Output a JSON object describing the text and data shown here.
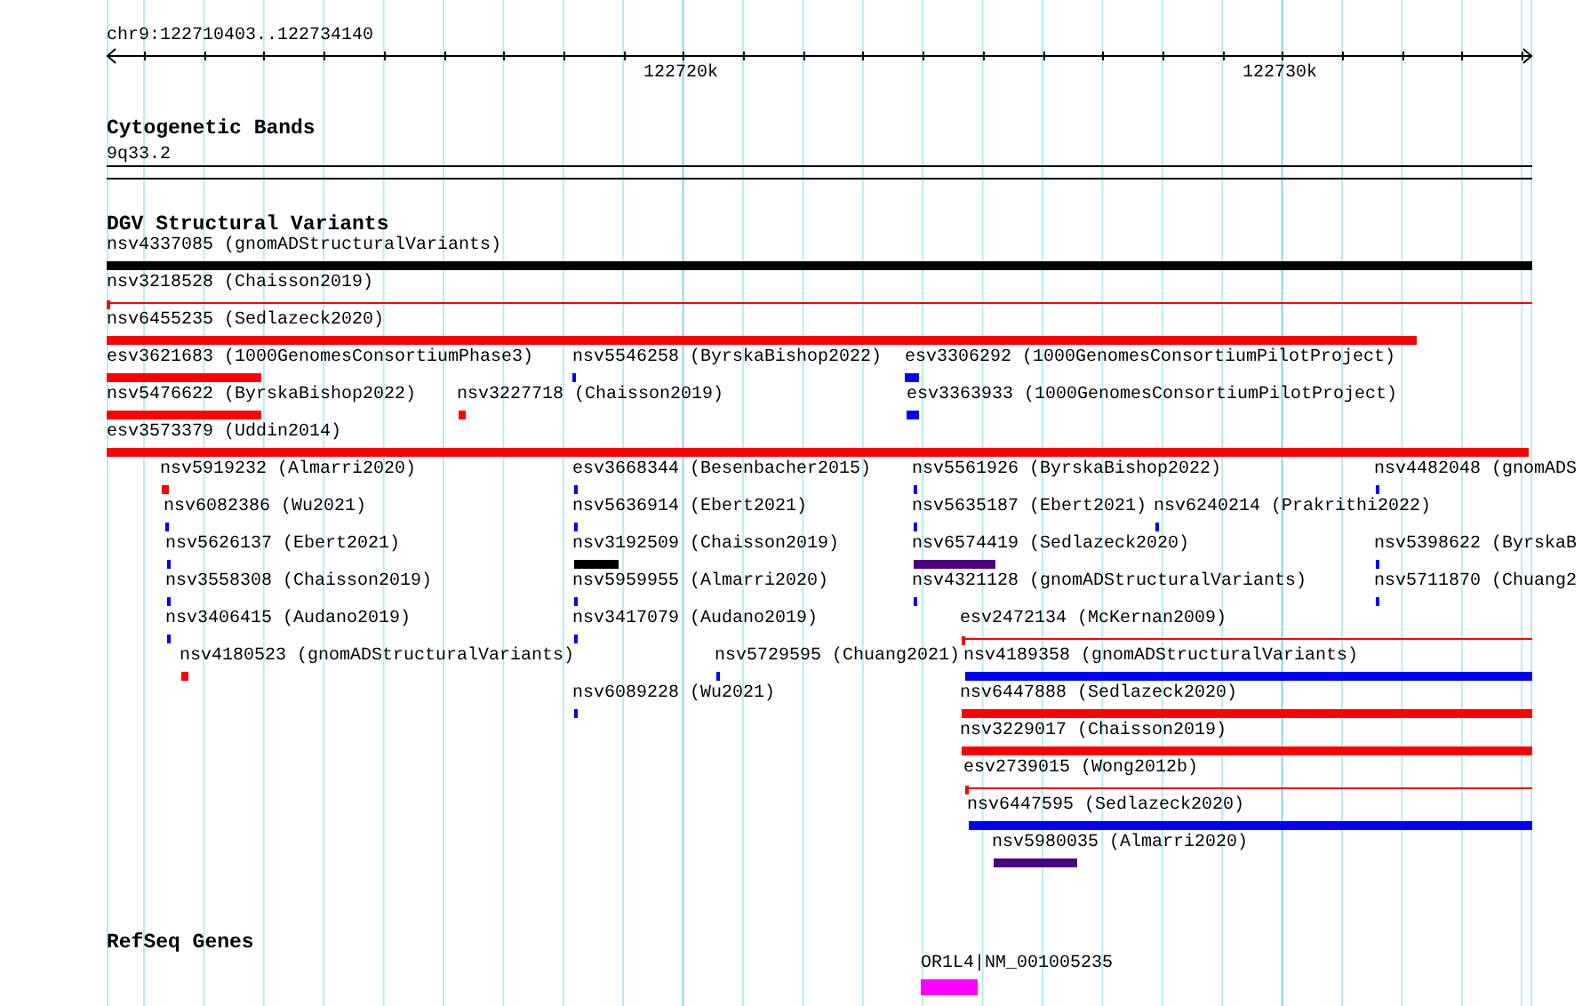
{
  "ruler": {
    "location": "chr9:122710403..122734140",
    "tick_labels": [
      "122720k",
      "122730k"
    ]
  },
  "tracks": [
    {
      "title": "Cytogenetic Bands",
      "features": [
        {
          "label": "9q33.2",
          "kind": "band",
          "color": "#000000"
        }
      ]
    },
    {
      "title": "DGV Structural Variants",
      "features": [
        {
          "label": "nsv4337085 (gnomADStructuralVariants)",
          "kind": "bar",
          "color": "#000000"
        },
        {
          "label": "nsv3218528 (Chaisson2019)",
          "kind": "line",
          "color": "#ff0000"
        },
        {
          "label": "nsv6455235 (Sedlazeck2020)",
          "kind": "bar",
          "color": "#ff0000"
        },
        {
          "label": "esv3621683 (1000GenomesConsortiumPhase3)",
          "kind": "bar",
          "color": "#ff0000"
        },
        {
          "label": "nsv5546258 (ByrskaBishop2022)",
          "kind": "bar",
          "color": "#0000ff"
        },
        {
          "label": "esv3306292 (1000GenomesConsortiumPilotProject)",
          "kind": "bar",
          "color": "#0000ff"
        },
        {
          "label": "nsv5476622 (ByrskaBishop2022)",
          "kind": "bar",
          "color": "#ff0000"
        },
        {
          "label": "nsv3227718 (Chaisson2019)",
          "kind": "bar",
          "color": "#ff0000"
        },
        {
          "label": "esv3363933 (1000GenomesConsortiumPilotProject)",
          "kind": "bar",
          "color": "#0000ff"
        },
        {
          "label": "esv3573379 (Uddin2014)",
          "kind": "bar",
          "color": "#ff0000"
        },
        {
          "label": "nsv5919232 (Almarri2020)",
          "kind": "bar",
          "color": "#ff0000"
        },
        {
          "label": "esv3668344 (Besenbacher2015)",
          "kind": "bar",
          "color": "#0000ff"
        },
        {
          "label": "nsv5561926 (ByrskaBishop2022)",
          "kind": "bar",
          "color": "#0000ff"
        },
        {
          "label": "nsv4482048 (gnomADS",
          "kind": "bar",
          "color": "#0000ff"
        },
        {
          "label": "nsv6082386 (Wu2021)",
          "kind": "bar",
          "color": "#0000ff"
        },
        {
          "label": "nsv5636914 (Ebert2021)",
          "kind": "bar",
          "color": "#0000ff"
        },
        {
          "label": "nsv5635187 (Ebert2021)",
          "kind": "bar",
          "color": "#0000ff"
        },
        {
          "label": "nsv6240214 (Prakrithi2022)",
          "kind": "bar",
          "color": "#0000ff"
        },
        {
          "label": "nsv5626137 (Ebert2021)",
          "kind": "bar",
          "color": "#0000ff"
        },
        {
          "label": "nsv3192509 (Chaisson2019)",
          "kind": "bar",
          "color": "#000000"
        },
        {
          "label": "nsv6574419 (Sedlazeck2020)",
          "kind": "bar",
          "color": "#4b0082"
        },
        {
          "label": "nsv5398622 (ByrskaB",
          "kind": "bar",
          "color": "#0000ff"
        },
        {
          "label": "nsv3558308 (Chaisson2019)",
          "kind": "bar",
          "color": "#0000ff"
        },
        {
          "label": "nsv5959955 (Almarri2020)",
          "kind": "bar",
          "color": "#0000ff"
        },
        {
          "label": "nsv4321128 (gnomADStructuralVariants)",
          "kind": "bar",
          "color": "#0000ff"
        },
        {
          "label": "nsv5711870 (Chuang2",
          "kind": "bar",
          "color": "#0000ff"
        },
        {
          "label": "nsv3406415 (Audano2019)",
          "kind": "bar",
          "color": "#0000ff"
        },
        {
          "label": "nsv3417079 (Audano2019)",
          "kind": "bar",
          "color": "#0000ff"
        },
        {
          "label": "esv2472134 (McKernan2009)",
          "kind": "line",
          "color": "#ff0000"
        },
        {
          "label": "nsv4180523 (gnomADStructuralVariants)",
          "kind": "bar",
          "color": "#ff0000"
        },
        {
          "label": "nsv5729595 (Chuang2021)",
          "kind": "bar",
          "color": "#0000ff"
        },
        {
          "label": "nsv4189358 (gnomADStructuralVariants)",
          "kind": "bar",
          "color": "#0000ff"
        },
        {
          "label": "nsv6089228 (Wu2021)",
          "kind": "bar",
          "color": "#0000ff"
        },
        {
          "label": "nsv6447888 (Sedlazeck2020)",
          "kind": "bar",
          "color": "#ff0000"
        },
        {
          "label": "nsv3229017 (Chaisson2019)",
          "kind": "bar",
          "color": "#ff0000"
        },
        {
          "label": "esv2739015 (Wong2012b)",
          "kind": "line",
          "color": "#ff0000"
        },
        {
          "label": "nsv6447595 (Sedlazeck2020)",
          "kind": "bar",
          "color": "#0000ff"
        },
        {
          "label": "nsv5980035 (Almarri2020)",
          "kind": "bar",
          "color": "#4b0082"
        }
      ]
    },
    {
      "title": "RefSeq Genes",
      "features": [
        {
          "label": "OR1L4|NM_001005235",
          "kind": "bar",
          "color": "#ff00ff"
        }
      ]
    }
  ]
}
